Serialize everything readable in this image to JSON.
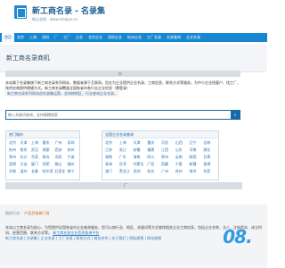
{
  "header": {
    "title": "新工商名录 - 名录集",
    "subtitle": "新企业网 · www.xinqiye.cn"
  },
  "nav": [
    {
      "label": "首页",
      "active": true
    },
    {
      "label": "北京"
    },
    {
      "label": "上海"
    },
    {
      "label": "深圳"
    },
    {
      "label": "厂"
    },
    {
      "label": "工厂"
    },
    {
      "label": "企业"
    },
    {
      "label": "北京企业"
    },
    {
      "label": "深圳企业"
    },
    {
      "label": "杭州企业"
    },
    {
      "label": "工厂名录"
    },
    {
      "label": "名录查询"
    },
    {
      "label": "企业名录"
    }
  ],
  "banner": {
    "title": "新工商名录商机"
  },
  "gray_bar": {
    "text": "口"
  },
  "desc": {
    "text": "本站属于名录集旗下新工商名录系列网站，数据来源于互联网，旨在为企业提供企业名录、工商信息、联系方式等服务，为中小企业找客户、找工厂、找供应商提供便捷方式。新工商名录覆盖全国各省市各行业企业信息（需登录）",
    "note": "新工商名录系列网站由名录集运营，支持按地区、行业查询企业名录。"
  },
  "search": {
    "placeholder": "输入关键词查询，支持模糊搜索",
    "button_icon": "search-icon"
  },
  "left_panel": {
    "title": "热门城市",
    "cities": [
      "北京",
      "天津",
      "上海",
      "重庆",
      "广州",
      "深圳",
      "杭州",
      "南京",
      "武汉",
      "成都",
      "西安",
      "苏州",
      "郑州",
      "长沙",
      "东莞",
      "青岛",
      "沈阳",
      "宁波",
      "昆明",
      "大连",
      "厦门",
      "合肥",
      "佛山",
      "福州",
      "济南",
      "温州",
      "长春",
      "哈尔滨",
      "石家庄",
      "南宁"
    ]
  },
  "right_panel": {
    "title": "全国企业名录查询",
    "cities": [
      "北京",
      "上海",
      "天津",
      "重庆",
      "河北",
      "山西",
      "辽宁",
      "吉林",
      "江苏",
      "浙江",
      "安徽",
      "福建",
      "江西",
      "山东",
      "河南",
      "湖北",
      "湖南",
      "广东",
      "海南",
      "四川",
      "贵州",
      "云南",
      "陕西",
      "甘肃",
      "青海",
      "台湾",
      "内蒙古",
      "广西",
      "西藏",
      "宁夏",
      "新疆",
      "香港",
      "澳门",
      "黑龙江",
      "深圳",
      "杭州",
      "广州",
      "苏州",
      "南京",
      "东莞"
    ]
  },
  "gray_bar2": {
    "text": "厂"
  },
  "footer": {
    "head_prefix": "相关行业：",
    "head_hot": "产品目录热门词",
    "text1": "本站以工商名录为核心，为您提供全国各省市企业查询服务，您可以按行业、地区、关键词等方式查找相关企业工商信息，包括企业名称、法人、注册资本、成立时间、经营范围、联系方式等。",
    "text1_link": "新工商名录企业信息查询平台",
    "text2": "新工商名录 | 名录集 | 企业名录 | 工厂名录 | 联系方式 | 商务合作 | 关于我们 | 隐私政策 | 网站地图"
  },
  "badge": {
    "text": "08",
    "dot": "."
  }
}
